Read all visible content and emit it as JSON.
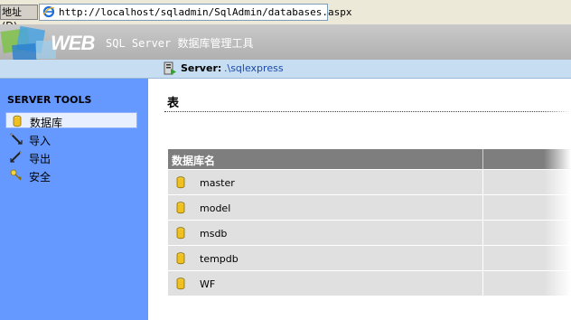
{
  "address_bar": {
    "label": "地址(D)",
    "url": "http://localhost/sqladmin/SqlAdmin/databases.aspx"
  },
  "header": {
    "logo_text": "WEB",
    "title": "SQL Server 数据库管理工具"
  },
  "server_bar": {
    "label": "Server:",
    "value": ".\\sqlexpress"
  },
  "sidebar": {
    "title": "SERVER TOOLS",
    "items": [
      {
        "label": "数据库",
        "icon": "database-icon",
        "active": true
      },
      {
        "label": "导入",
        "icon": "import-icon",
        "active": false
      },
      {
        "label": "导出",
        "icon": "export-icon",
        "active": false
      },
      {
        "label": "安全",
        "icon": "key-icon",
        "active": false
      }
    ]
  },
  "main": {
    "title": "表",
    "table": {
      "header": "数据库名",
      "rows": [
        "master",
        "model",
        "msdb",
        "tempdb",
        "WF"
      ]
    }
  },
  "colors": {
    "sidebar_bg": "#6699ff",
    "header_bg": "#b8b8b8",
    "server_bar_bg": "#c6ddf2",
    "table_header_bg": "#7e7e7e",
    "table_row_bg": "#e0e0e0"
  }
}
